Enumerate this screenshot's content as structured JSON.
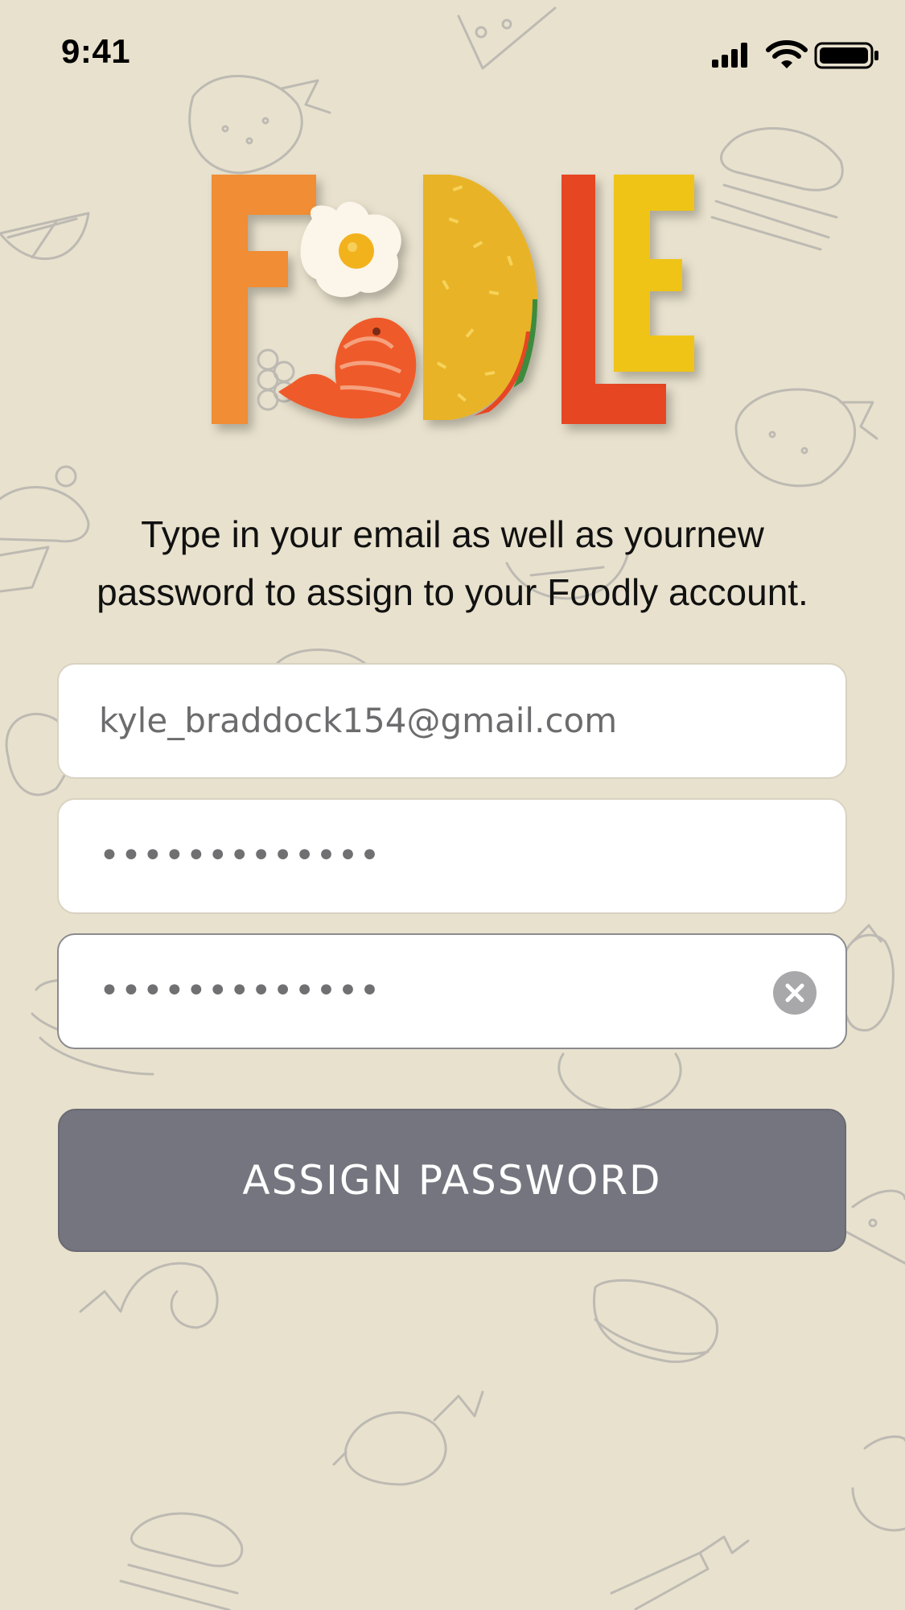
{
  "status_bar": {
    "time": "9:41",
    "icons": [
      "signal-icon",
      "wifi-icon",
      "battery-icon"
    ]
  },
  "logo": {
    "name": "FOODLE",
    "colors": {
      "f": "#f08d35",
      "egg_yolk": "#f2b21c",
      "shrimp": "#ef5a2a",
      "taco": "#e8b326",
      "l": "#e64624",
      "e": "#f0c419"
    }
  },
  "instructions": {
    "line1": "Type in your email as well as yournew",
    "line2": "password to assign to your Foodly account."
  },
  "form": {
    "email_value": "kyle_braddock154@gmail.com",
    "password_value": "•••••••••••••",
    "confirm_password_value": "•••••••••••••",
    "clear_icon": "close-circle-icon"
  },
  "assign_button": {
    "label": "ASSIGN PASSWORD",
    "color": "#75757f"
  },
  "background": {
    "color": "#e8e1cd",
    "doodle_color": "#bdbab3"
  }
}
